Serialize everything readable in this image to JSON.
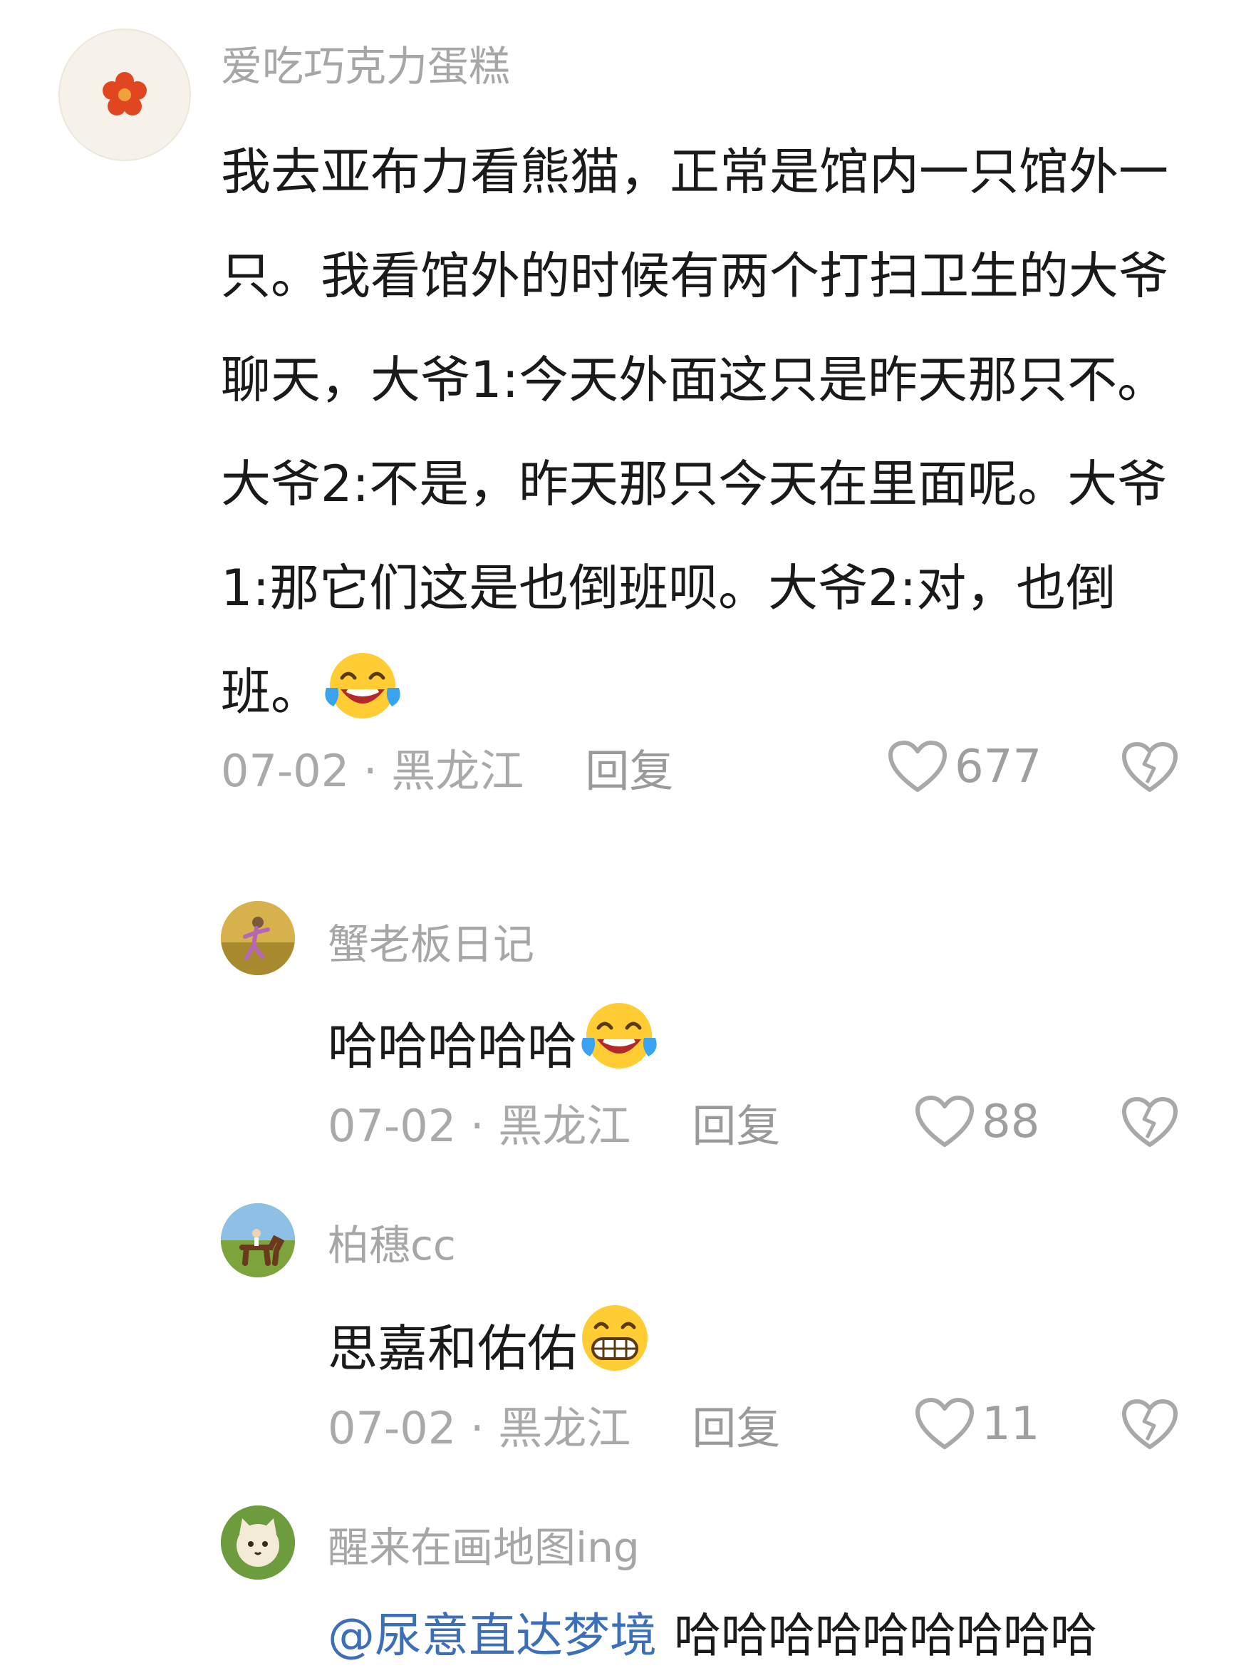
{
  "comments": [
    {
      "username": "爱吃巧克力蛋糕",
      "text": "我去亚布力看熊猫，正常是馆内一只馆外一只。我看馆外的时候有两个打扫卫生的大爷聊天，大爷1:今天外面这只是昨天那只不。大爷2:不是，昨天那只今天在里面呢。大爷1:那它们这是也倒班呗。大爷2:对，也倒班。",
      "emoji": "laughing-tears-emoji",
      "date": "07-02",
      "location": "黑龙江",
      "reply_label": "回复",
      "likes": "677"
    },
    {
      "username": "蟹老板日记",
      "text": "哈哈哈哈哈",
      "emoji": "laughing-tears-emoji",
      "date": "07-02",
      "location": "黑龙江",
      "reply_label": "回复",
      "likes": "88"
    },
    {
      "username": "柏穗cc",
      "text": "思嘉和佑佑",
      "emoji": "grinning-emoji",
      "date": "07-02",
      "location": "黑龙江",
      "reply_label": "回复",
      "likes": "11"
    },
    {
      "username": "醒来在画地图ing",
      "mention": "@尿意直达梦境",
      "text": "哈哈哈哈哈哈哈哈哈"
    }
  ],
  "separator": " · ",
  "colors": {
    "username": "#a6a6a6",
    "body_text": "#1a1a1a",
    "meta": "#a9a9a9",
    "mention": "#3d6fb8",
    "avatar_flower": "#e0461f"
  }
}
